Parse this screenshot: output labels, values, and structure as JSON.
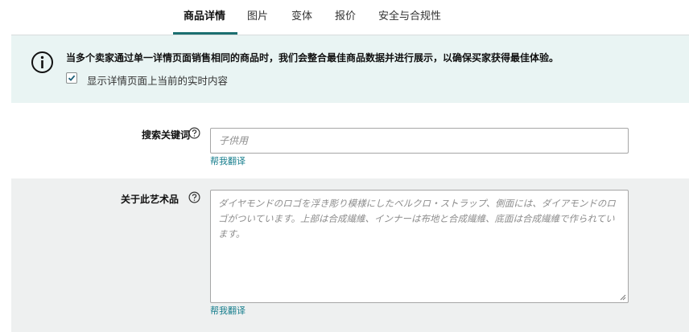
{
  "tabs": [
    {
      "label": "商品详情",
      "active": true
    },
    {
      "label": "图片",
      "active": false
    },
    {
      "label": "变体",
      "active": false
    },
    {
      "label": "报价",
      "active": false
    },
    {
      "label": "安全与合规性",
      "active": false
    }
  ],
  "info": {
    "message": "当多个卖家通过单一详情页面销售相同的商品时，我们会整合最佳商品数据并进行展示，以确保买家获得最佳体验。",
    "checkbox_label": "显示详情页面上当前的实时内容",
    "checkbox_checked": true
  },
  "keywords": {
    "label": "搜索关键词",
    "placeholder": "子供用",
    "translate_link": "帮我翻译"
  },
  "description": {
    "label": "关于此艺术品",
    "placeholder": "ダイヤモンドのロゴを浮き彫り模様にしたベルクロ・ストラップ、側面には、ダイアモンドのロゴがついています。上部は合成繊維、インナーは布地と合成繊維、底面は合成繊維で作られています。",
    "translate_link": "帮我翻译"
  },
  "colors": {
    "accent": "#1b6f70",
    "info_bg": "#e9f4f3",
    "link": "#157d8c"
  }
}
